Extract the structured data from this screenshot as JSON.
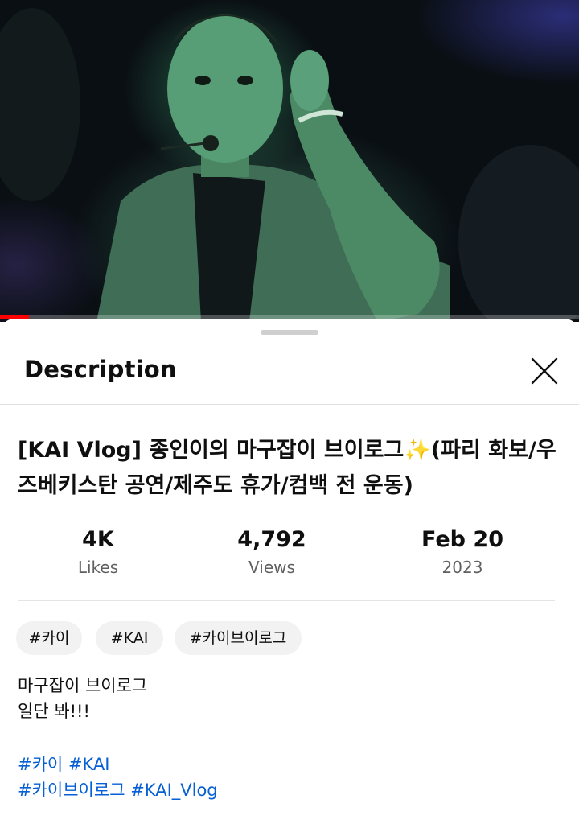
{
  "video": {
    "progress_fraction": 0.05
  },
  "sheet": {
    "title": "Description"
  },
  "video_title": "[KAI Vlog] 종인이의 마구잡이 브이로그✨(파리 화보/우즈베키스탄 공연/제주도 휴가/컴백 전 운동)",
  "stats": {
    "likes": {
      "value": "4K",
      "label": "Likes"
    },
    "views": {
      "value": "4,792",
      "label": "Views"
    },
    "date": {
      "value": "Feb 20",
      "label": "2023"
    }
  },
  "chips": [
    "#카이",
    "#KAI",
    "#카이브이로그"
  ],
  "description": {
    "lines": [
      "마구잡이 브이로그",
      "일단 봐!!!"
    ],
    "hashtag_line_1": [
      "#카이",
      "#KAI"
    ],
    "hashtag_line_2": [
      "#카이브이로그",
      "#KAI_Vlog"
    ]
  },
  "colors": {
    "accent_link": "#065fd4",
    "progress": "#ff0000",
    "chip_bg": "#f2f2f2",
    "secondary_text": "#606060"
  },
  "icons": {
    "close": "close-icon"
  }
}
